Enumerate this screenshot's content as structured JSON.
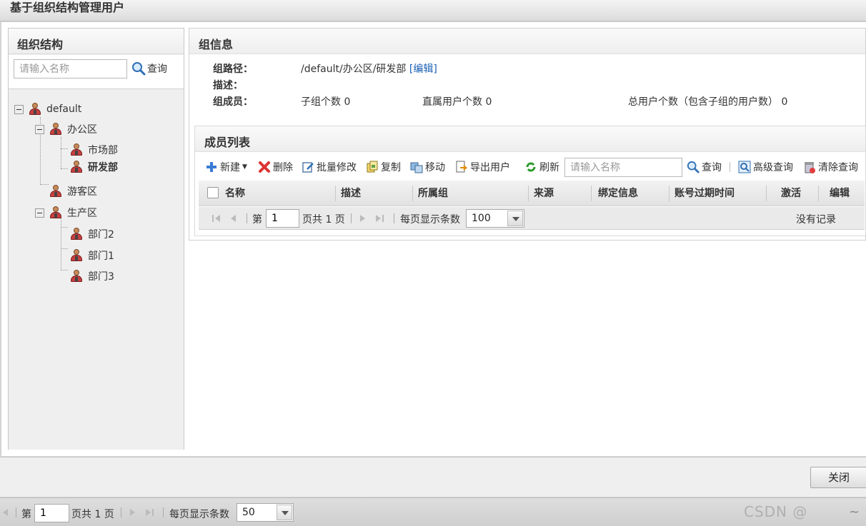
{
  "window": {
    "title": "基于组织结构管理用户"
  },
  "left": {
    "title": "组织结构",
    "search_placeholder": "请输入名称",
    "search_button": "查询",
    "tree": {
      "root": "default",
      "office": "办公区",
      "market": "市场部",
      "rd": "研发部",
      "guest": "游客区",
      "production": "生产区",
      "dept2": "部门2",
      "dept1": "部门1",
      "dept3": "部门3"
    }
  },
  "group_info": {
    "title": "组信息",
    "path_label": "组路径：",
    "path_value": "/default/办公区/研发部",
    "edit_link": "[编辑]",
    "desc_label": "描述：",
    "members_label": "组成员：",
    "subgroup_count": "子组个数 0",
    "direct_users": "直属用户个数 0",
    "total_users": "总用户个数（包含子组的用户数） 0"
  },
  "members": {
    "title": "成员列表",
    "toolbar": {
      "new": "新建",
      "delete": "删除",
      "batch_edit": "批量修改",
      "copy": "复制",
      "move": "移动",
      "export": "导出用户",
      "refresh": "刷新",
      "search_placeholder": "请输入名称",
      "query": "查询",
      "advanced": "高级查询",
      "clear": "清除查询"
    },
    "columns": [
      "名称",
      "描述",
      "所属组",
      "来源",
      "绑定信息",
      "账号过期时间",
      "激活",
      "编辑"
    ],
    "pager": {
      "page_prefix": "第",
      "page_value": "1",
      "page_suffix": "页共 1 页",
      "per_page_label": "每页显示条数",
      "per_page_value": "100",
      "empty_text": "没有记录"
    }
  },
  "footer": {
    "close_button": "关闭"
  },
  "background_pager": {
    "page_prefix": "第",
    "page_value": "1",
    "page_suffix": "页共 1 页",
    "per_page_label": "每页显示条数",
    "per_page_value": "50",
    "watermark": "CSDN @",
    "tilde": "~"
  },
  "colors": {
    "link": "#1a5fb4",
    "panel_bg": "#efefef",
    "header_bg": "#eeeeee"
  }
}
